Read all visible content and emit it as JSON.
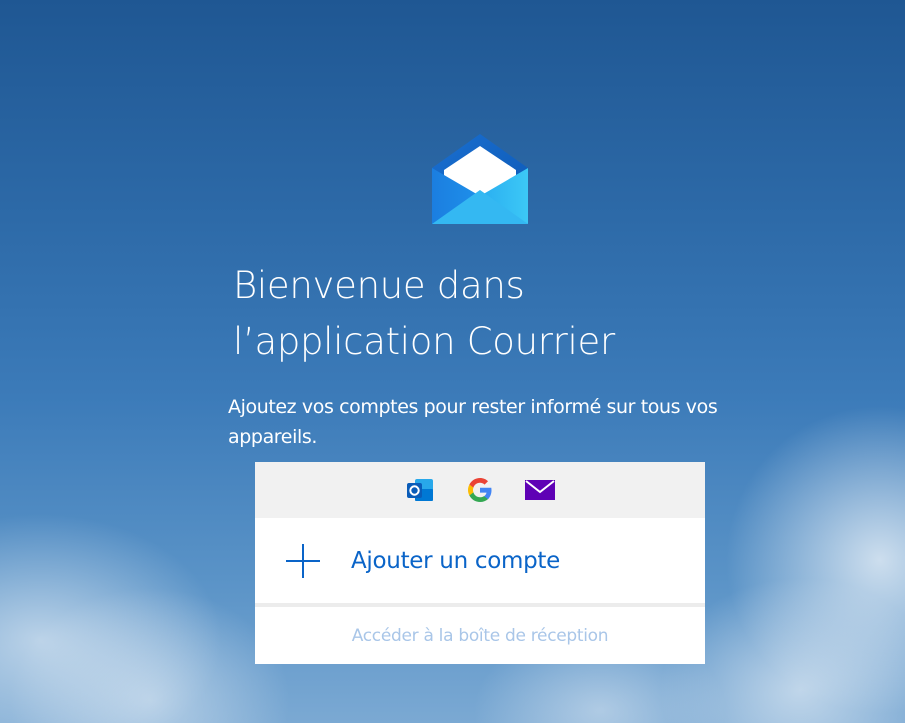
{
  "app": {
    "logo_icon": "mail-envelope-icon",
    "title": "Bienvenue dans l’application Courrier",
    "subtitle": "Ajoutez vos comptes pour rester informé sur tous vos appareils."
  },
  "providers": [
    {
      "name": "outlook-icon",
      "color": "#0a64c8"
    },
    {
      "name": "google-icon",
      "color": "#4285f4"
    },
    {
      "name": "mail-generic-icon",
      "color": "#5f01b5"
    }
  ],
  "actions": {
    "add_account_label": "Ajouter un compte",
    "add_account_icon": "plus-icon",
    "go_to_inbox_label": "Accéder à la boîte de réception"
  },
  "colors": {
    "accent": "#0a64c8",
    "disabled_text": "#a9c6e8",
    "strip_background": "#f1f1f1"
  }
}
